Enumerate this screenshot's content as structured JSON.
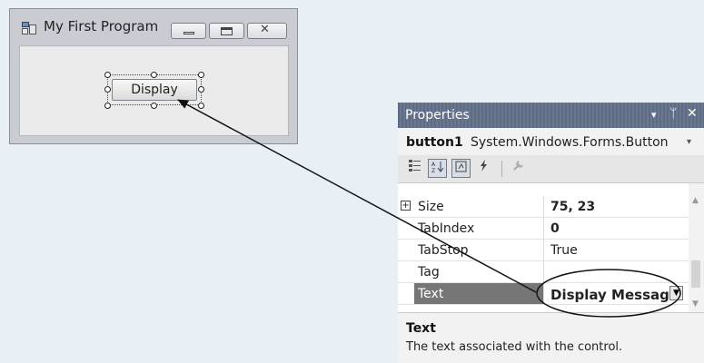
{
  "form_window": {
    "title": "My First Program",
    "button_text": "Display",
    "icons": {
      "app": "form-app-icon",
      "minimize": "minimize-icon",
      "maximize": "maximize-icon",
      "close": "close-icon"
    }
  },
  "properties": {
    "header_label": "Properties",
    "header_glyphs": {
      "dropdown": "▾",
      "pin": "ᛘ",
      "close": "✕"
    },
    "object_name": "button1",
    "object_type": "System.Windows.Forms.Button",
    "toolbar_icons": [
      "categorized-icon",
      "alphabetical-icon",
      "properties-icon",
      "events-icon",
      "property-pages-icon"
    ],
    "rows": [
      {
        "name": "Size",
        "value": "75, 23",
        "expandable": true,
        "bold_value": true
      },
      {
        "name": "TabIndex",
        "value": "0",
        "bold_value": true
      },
      {
        "name": "TabStop",
        "value": "True"
      },
      {
        "name": "Tag",
        "value": ""
      },
      {
        "name": "Text",
        "value": "Display Message",
        "selected": true,
        "bold_value": true
      }
    ],
    "description_title": "Text",
    "description_text": "The text associated with the control."
  },
  "colors": {
    "background": "#e8f0f5",
    "header": "#5d6b83",
    "selected_row": "#767676"
  }
}
